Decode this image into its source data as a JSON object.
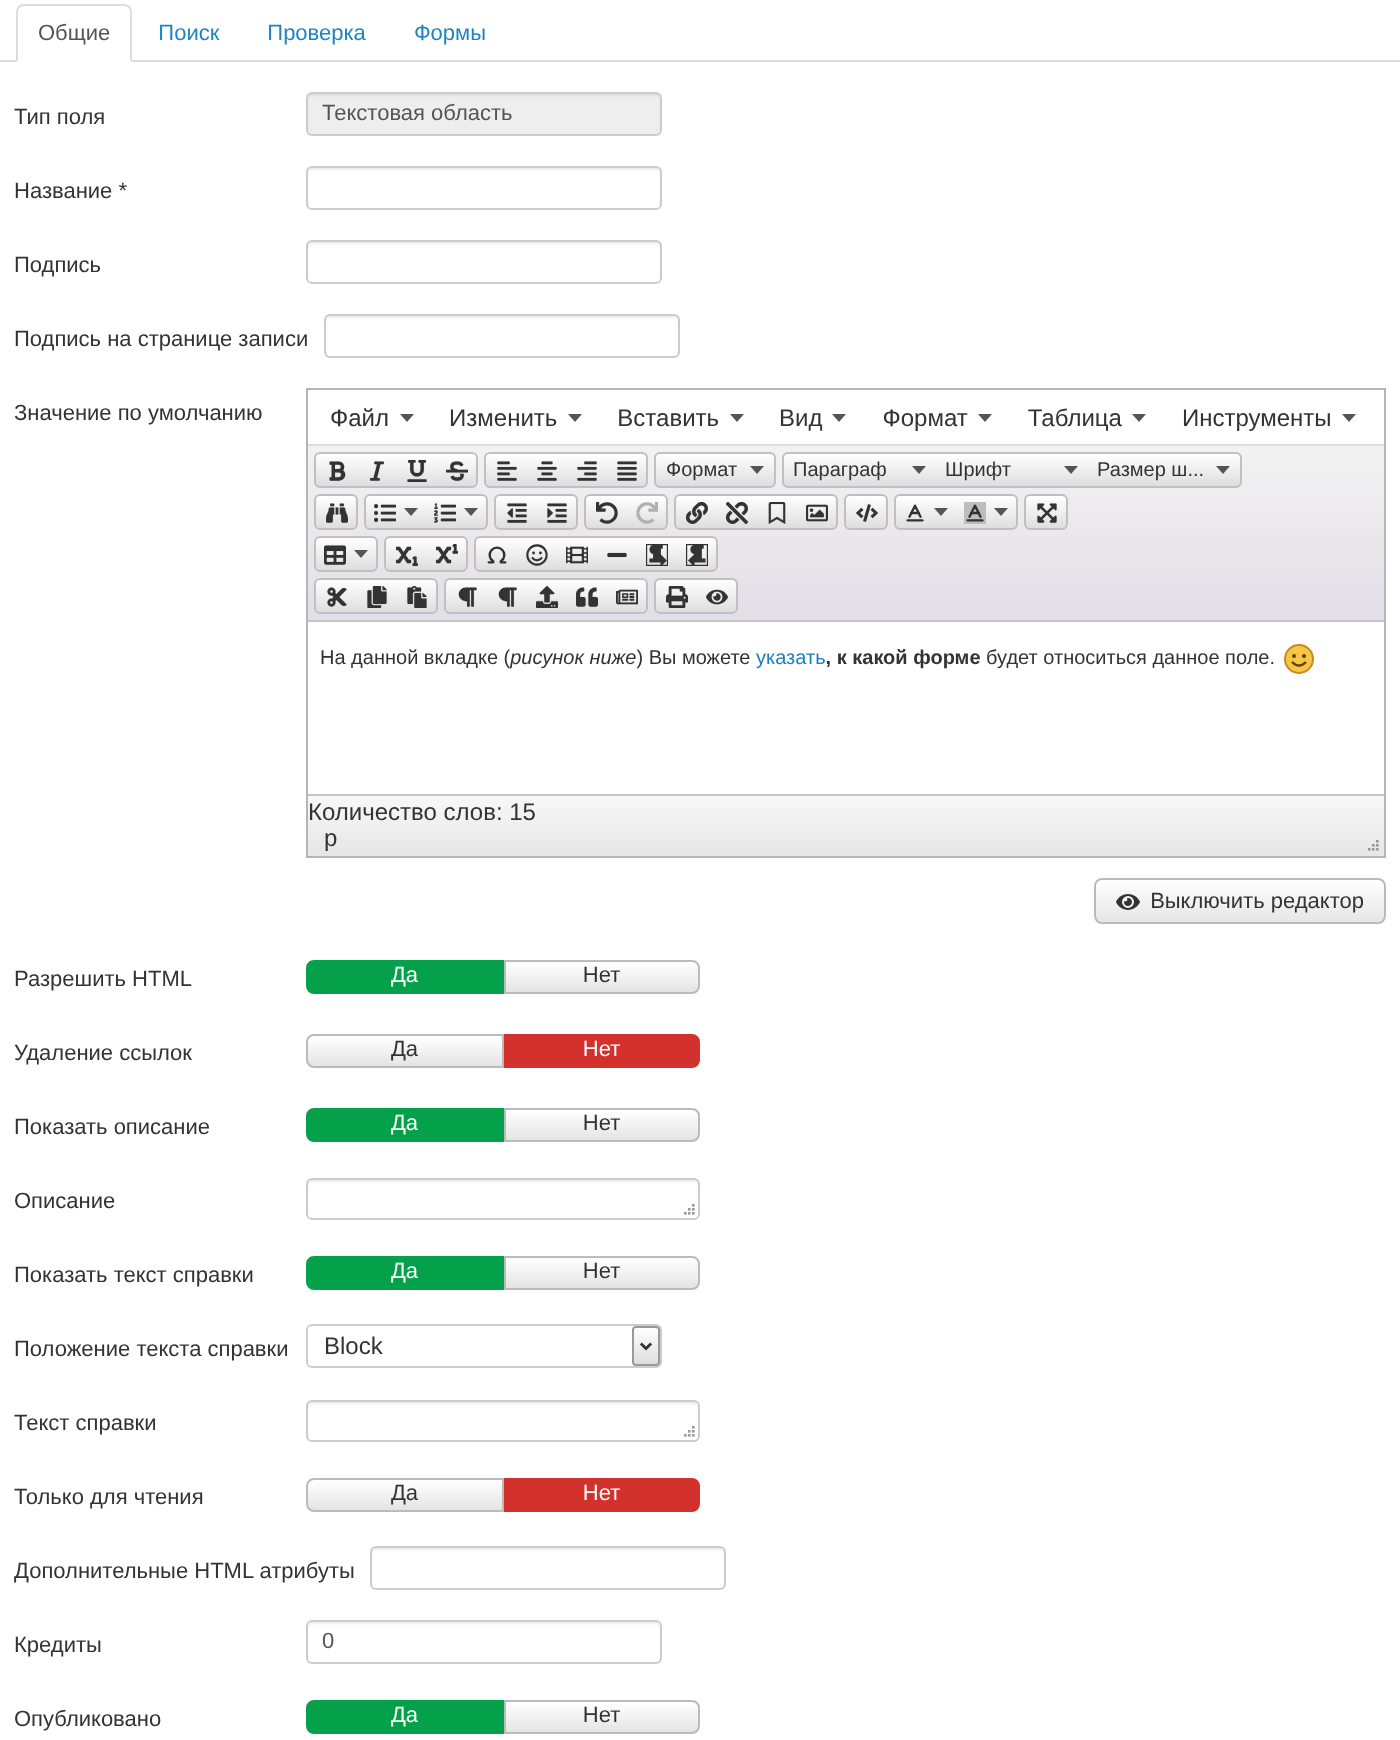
{
  "tabs": [
    {
      "label": "Общие",
      "selected": true
    },
    {
      "label": "Поиск",
      "selected": false
    },
    {
      "label": "Проверка",
      "selected": false
    },
    {
      "label": "Формы",
      "selected": false
    }
  ],
  "fields": [
    {
      "kind": "readonly",
      "label": "Тип поля",
      "value": "Текстовая область"
    },
    {
      "kind": "input",
      "label": "Название *"
    },
    {
      "kind": "input",
      "label": "Подпись"
    },
    {
      "kind": "input",
      "label": "Подпись на странице записи"
    },
    {
      "kind": "editor",
      "label": "Значение по умолчанию",
      "editor": {
        "menu": [
          "Файл",
          "Изменить",
          "Вставить",
          "Вид",
          "Формат",
          "Таблица",
          "Инструменты"
        ],
        "toolbar": [
          [
            [
              {
                "kind": "icon",
                "disabled": false
              },
              {
                "kind": "icon",
                "disabled": false
              },
              {
                "kind": "icon",
                "disabled": false
              },
              {
                "kind": "icon",
                "disabled": false
              }
            ],
            [
              {
                "kind": "icon",
                "disabled": false
              },
              {
                "kind": "icon",
                "disabled": false
              },
              {
                "kind": "icon",
                "disabled": false
              },
              {
                "kind": "icon",
                "disabled": false
              }
            ],
            [
              {
                "kind": "select",
                "label": "Формат",
                "disabled": false
              }
            ],
            [
              {
                "kind": "select",
                "label": "Параграф",
                "disabled": false
              },
              {
                "kind": "select",
                "label": "Шрифт",
                "disabled": false
              },
              {
                "kind": "select",
                "label": "Размер ш...",
                "disabled": false
              }
            ]
          ],
          [
            [
              {
                "kind": "icon",
                "disabled": false
              }
            ],
            [
              {
                "kind": "split",
                "disabled": false
              },
              {
                "kind": "split",
                "disabled": false
              }
            ],
            [
              {
                "kind": "icon",
                "disabled": false
              },
              {
                "kind": "icon",
                "disabled": false
              }
            ],
            [
              {
                "kind": "icon",
                "disabled": false
              },
              {
                "kind": "icon",
                "disabled": true
              }
            ],
            [
              {
                "kind": "icon",
                "disabled": false
              },
              {
                "kind": "icon",
                "disabled": false
              },
              {
                "kind": "icon",
                "disabled": false
              },
              {
                "kind": "icon",
                "disabled": false
              }
            ],
            [
              {
                "kind": "icon",
                "disabled": false
              }
            ],
            [
              {
                "kind": "split",
                "disabled": false
              },
              {
                "kind": "split",
                "disabled": false
              }
            ],
            [
              {
                "kind": "icon",
                "disabled": false
              }
            ]
          ],
          [
            [
              {
                "kind": "split",
                "disabled": false
              }
            ],
            [
              {
                "kind": "icon",
                "disabled": false
              },
              {
                "kind": "icon",
                "disabled": false
              }
            ],
            [
              {
                "kind": "icon",
                "disabled": false
              },
              {
                "kind": "icon",
                "disabled": false
              },
              {
                "kind": "icon",
                "disabled": false
              },
              {
                "kind": "icon",
                "disabled": false
              },
              {
                "kind": "icon",
                "disabled": false
              },
              {
                "kind": "icon",
                "disabled": false
              }
            ]
          ],
          [
            [
              {
                "kind": "icon",
                "disabled": false
              },
              {
                "kind": "icon",
                "disabled": false
              },
              {
                "kind": "icon",
                "disabled": false
              }
            ],
            [
              {
                "kind": "icon",
                "disabled": false
              },
              {
                "kind": "icon",
                "disabled": false
              },
              {
                "kind": "icon",
                "disabled": false
              },
              {
                "kind": "icon",
                "disabled": false
              },
              {
                "kind": "icon",
                "disabled": false
              }
            ],
            [
              {
                "kind": "icon",
                "disabled": false
              },
              {
                "kind": "icon",
                "disabled": false
              }
            ]
          ]
        ],
        "content": {
          "before": "На данной вкладке (*рисунок ниже*) Вы можете ",
          "link": "указать",
          "after": "**, к какой форме** будет относиться данное поле."
        },
        "word_count": "Количество слов: 15",
        "path": "p",
        "toggle_button": "Выключить редактор"
      }
    },
    {
      "kind": "toggle",
      "label": "Разрешить HTML",
      "options": [
        {
          "label": "Да",
          "selected": true
        },
        {
          "label": "Нет",
          "selected": false
        }
      ]
    },
    {
      "kind": "toggle",
      "label": "Удаление ссылок",
      "options": [
        {
          "label": "Да",
          "selected": false
        },
        {
          "label": "Нет",
          "selected": true
        }
      ]
    },
    {
      "kind": "toggle",
      "label": "Показать описание",
      "options": [
        {
          "label": "Да",
          "selected": true
        },
        {
          "label": "Нет",
          "selected": false
        }
      ]
    },
    {
      "kind": "textarea",
      "label": "Описание"
    },
    {
      "kind": "toggle",
      "label": "Показать текст справки",
      "options": [
        {
          "label": "Да",
          "selected": true
        },
        {
          "label": "Нет",
          "selected": false
        }
      ]
    },
    {
      "kind": "select",
      "label": "Положение текста справки",
      "value": "Block"
    },
    {
      "kind": "textarea",
      "label": "Текст справки"
    },
    {
      "kind": "toggle",
      "label": "Только для чтения",
      "options": [
        {
          "label": "Да",
          "selected": false
        },
        {
          "label": "Нет",
          "selected": true
        }
      ]
    },
    {
      "kind": "input",
      "label": "Дополнительные HTML атрибуты"
    },
    {
      "kind": "input",
      "label": "Кредиты",
      "value": "0"
    },
    {
      "kind": "toggle",
      "label": "Опубликовано",
      "options": [
        {
          "label": "Да",
          "selected": true
        },
        {
          "label": "Нет",
          "selected": false
        }
      ]
    }
  ]
}
